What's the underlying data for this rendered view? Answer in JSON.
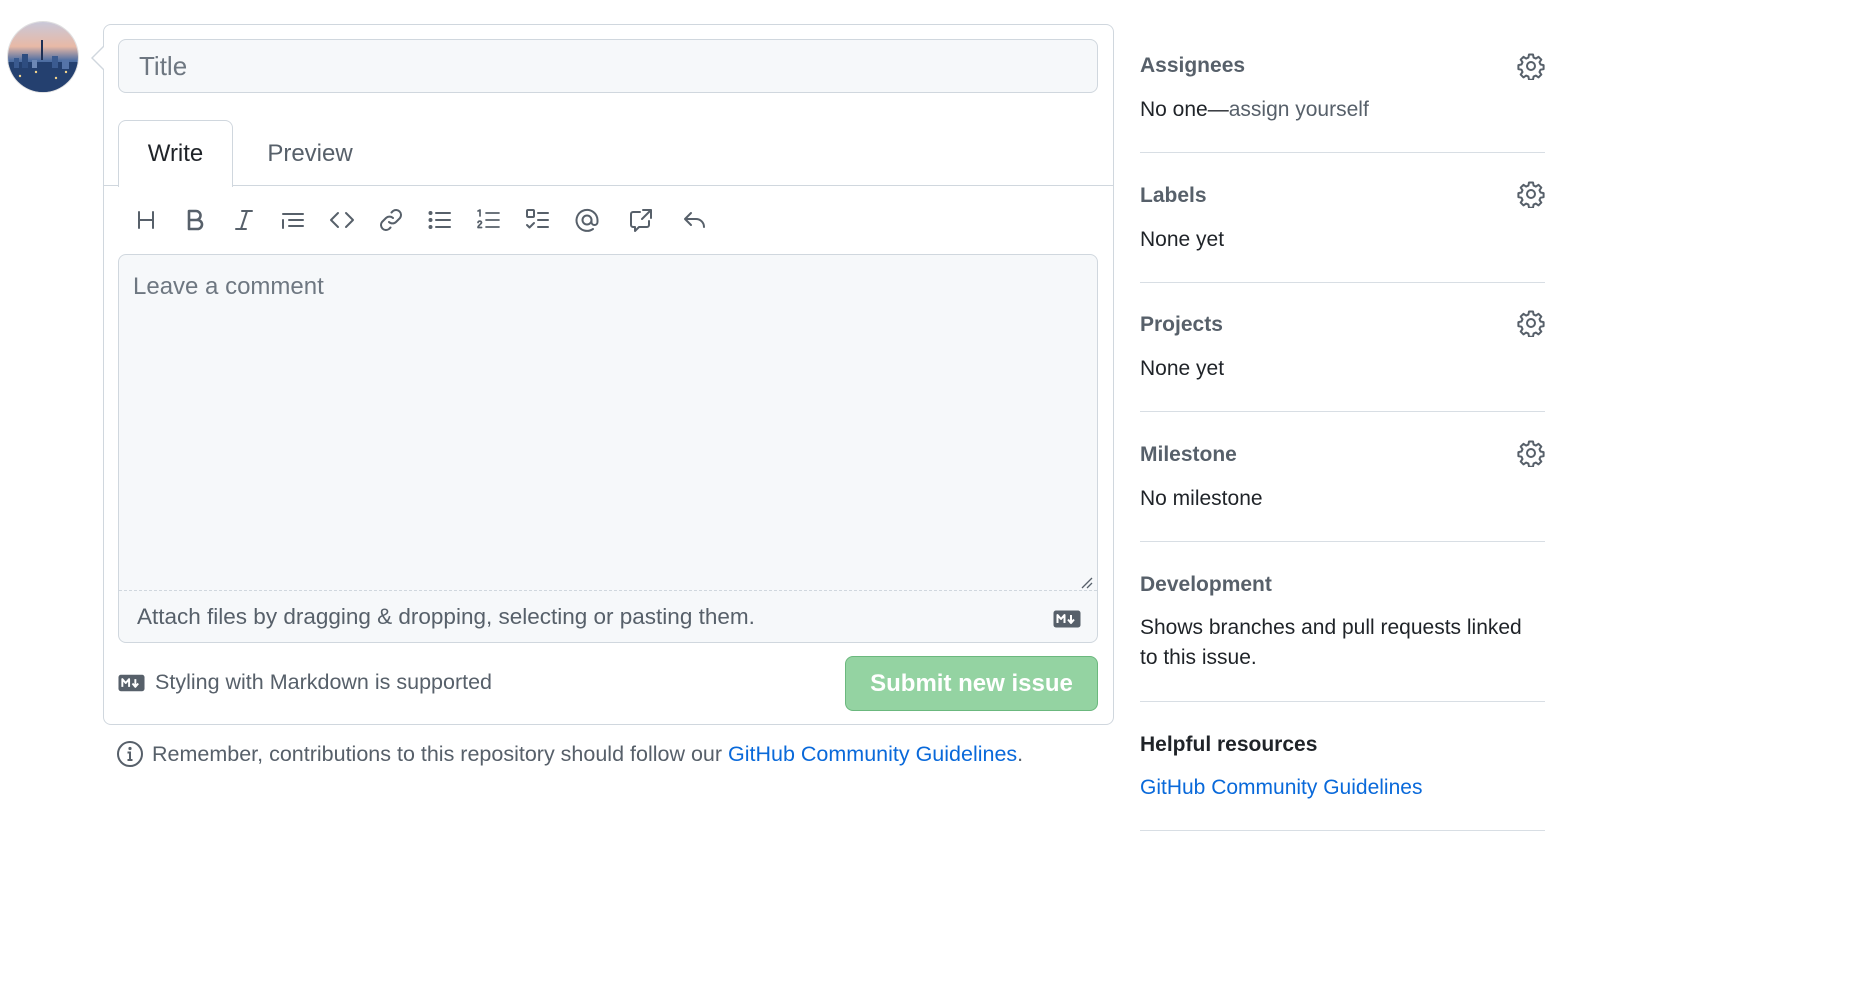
{
  "form": {
    "title_placeholder": "Title",
    "tabs": [
      {
        "label": "Write",
        "active": true
      },
      {
        "label": "Preview",
        "active": false
      }
    ],
    "toolbar": [
      {
        "name": "heading-icon"
      },
      {
        "name": "bold-icon"
      },
      {
        "name": "italic-icon"
      },
      {
        "name": "quote-icon"
      },
      {
        "name": "code-icon"
      },
      {
        "name": "link-icon"
      },
      {
        "name": "unordered-list-icon"
      },
      {
        "name": "ordered-list-icon"
      },
      {
        "name": "task-list-icon"
      },
      {
        "name": "mention-icon"
      },
      {
        "name": "cross-reference-icon"
      },
      {
        "name": "reply-icon"
      }
    ],
    "comment_placeholder": "Leave a comment",
    "attach_text": "Attach files by dragging & dropping, selecting or pasting them.",
    "markdown_note": "Styling with Markdown is supported",
    "submit_label": "Submit new issue"
  },
  "guideline": {
    "prefix": "Remember, contributions to this repository should follow our ",
    "link": "GitHub Community Guidelines",
    "suffix": "."
  },
  "sidebar": {
    "assignees": {
      "heading": "Assignees",
      "value_prefix": "No one—",
      "value_link": "assign yourself"
    },
    "labels": {
      "heading": "Labels",
      "value": "None yet"
    },
    "projects": {
      "heading": "Projects",
      "value": "None yet"
    },
    "milestone": {
      "heading": "Milestone",
      "value": "No milestone"
    },
    "development": {
      "heading": "Development",
      "value": "Shows branches and pull requests linked to this issue."
    },
    "helpful": {
      "heading": "Helpful resources",
      "link": "GitHub Community Guidelines"
    }
  },
  "colors": {
    "accent_link": "#0969da",
    "submit_disabled": "#94d3a2",
    "border": "#d0d7de",
    "muted_text": "#57606a"
  }
}
